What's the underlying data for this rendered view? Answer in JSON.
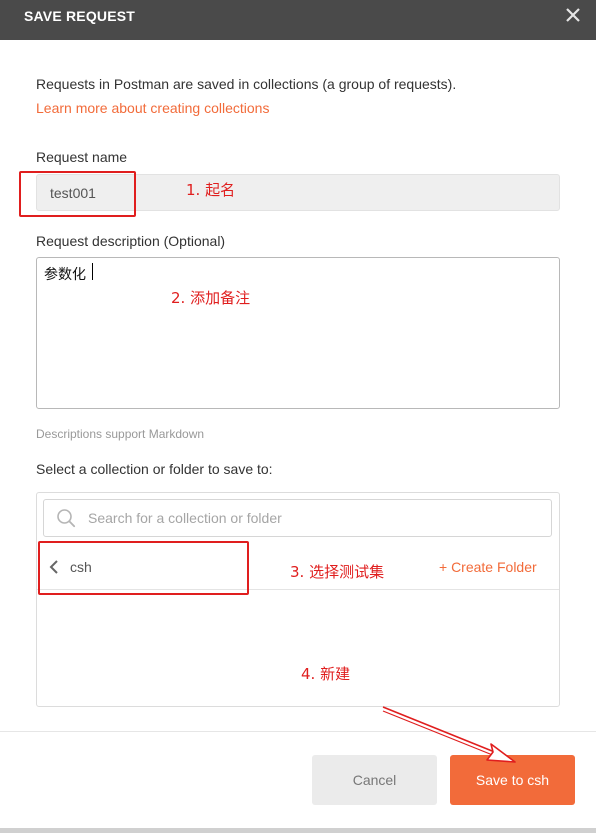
{
  "dialog": {
    "title": "SAVE REQUEST",
    "close_icon": "close-icon"
  },
  "intro": {
    "text": "Requests in Postman are saved in collections (a group of requests).",
    "learn_link": "Learn more about creating collections"
  },
  "request_name": {
    "label": "Request name",
    "value": "test001"
  },
  "request_description": {
    "label": "Request description (Optional)",
    "value": "参数化",
    "hint": "Descriptions support Markdown"
  },
  "collection": {
    "label": "Select a collection or folder to save to:",
    "search_placeholder": "Search for a collection or folder",
    "search_icon": "search-icon",
    "breadcrumb": "csh",
    "back_icon": "chevron-left-icon",
    "create_folder": "+ Create Folder"
  },
  "footer": {
    "cancel_label": "Cancel",
    "save_label": "Save to csh"
  },
  "annotations": {
    "note_1": "1. 起名",
    "note_2": "2. 添加备注",
    "note_3": "3. 选择测试集",
    "note_4": "4. 新建"
  },
  "colors": {
    "accent": "#f26b3a",
    "title_bar": "#4a4a4a",
    "annotation": "#e01e1e"
  }
}
